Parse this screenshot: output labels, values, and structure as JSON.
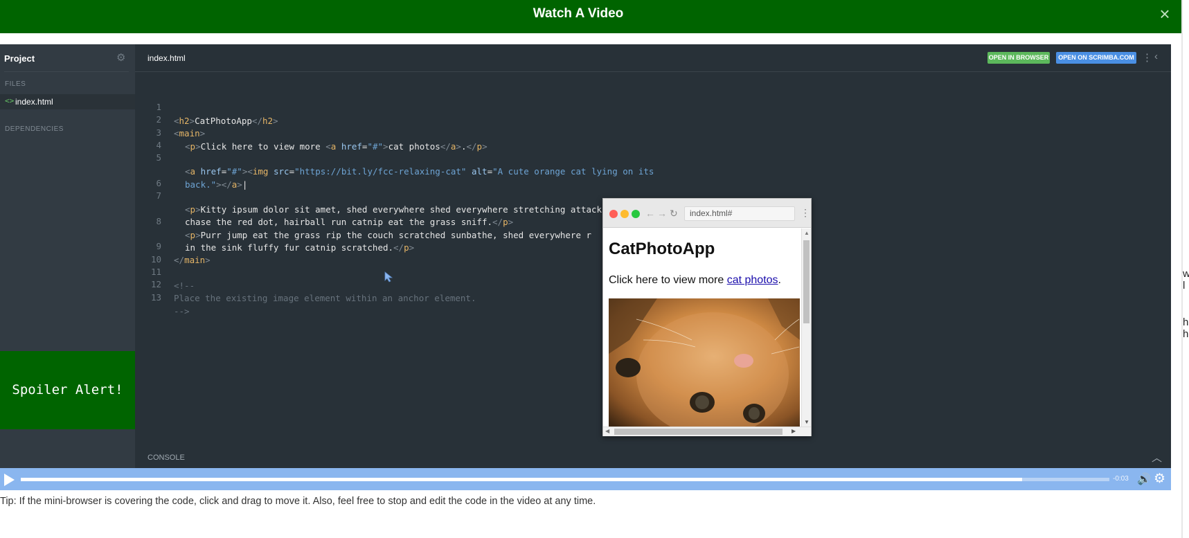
{
  "modal": {
    "title": "Watch A Video",
    "close_icon": "×"
  },
  "sidebar": {
    "title": "Project",
    "files_label": "FILES",
    "file_icon": "<>",
    "file_name": "index.html",
    "dependencies_label": "DEPENDENCIES"
  },
  "spoiler": {
    "text": "Spoiler Alert!",
    "color": "#006400"
  },
  "tabbar": {
    "file": "index.html",
    "open_in_browser": "OPEN IN BROWSER",
    "open_on_scrimba": "OPEN ON SCRIMBA.COM"
  },
  "editor": {
    "line_numbers": [
      "1",
      "2",
      "3",
      "4",
      "5",
      "",
      "6",
      "7",
      "",
      "8",
      "",
      "9",
      "10",
      "11",
      "12",
      "13"
    ],
    "url": "https://bit.ly/fcc-relaxing-cat",
    "alt_1": "A cute orange cat lying on its",
    "alt_2": "back.",
    "h2_text": "CatPhotoApp",
    "p1_text": "Click here to view more ",
    "p1_link": "cat photos",
    "p2_line1": "Kitty ipsum dolor sit amet, shed everywhere shed everywhere stretching attack your ankles",
    "p2_line2": "chase the red dot, hairball run catnip eat the grass sniff.",
    "p3_line1": "Purr jump eat the grass rip the couch scratched sunbathe, shed everywhere r",
    "p3_line2": "in the sink fluffy fur catnip scratched.",
    "comment_open": "<!--",
    "comment_text": "Place the existing image element within an anchor element.",
    "comment_close": "-->"
  },
  "console": {
    "label": "CONSOLE"
  },
  "mini_browser": {
    "url": "index.html#",
    "heading": "CatPhotoApp",
    "paragraph": "Click here to view more ",
    "link": "cat photos",
    "punct": "."
  },
  "player": {
    "time": "-0:03",
    "progress_percent": 92,
    "accent": "#8ab6ef"
  },
  "tip": "Tip: If the mini-browser is covering the code, click and drag to move it. Also, feel free to stop and edit the code in the video at any time."
}
